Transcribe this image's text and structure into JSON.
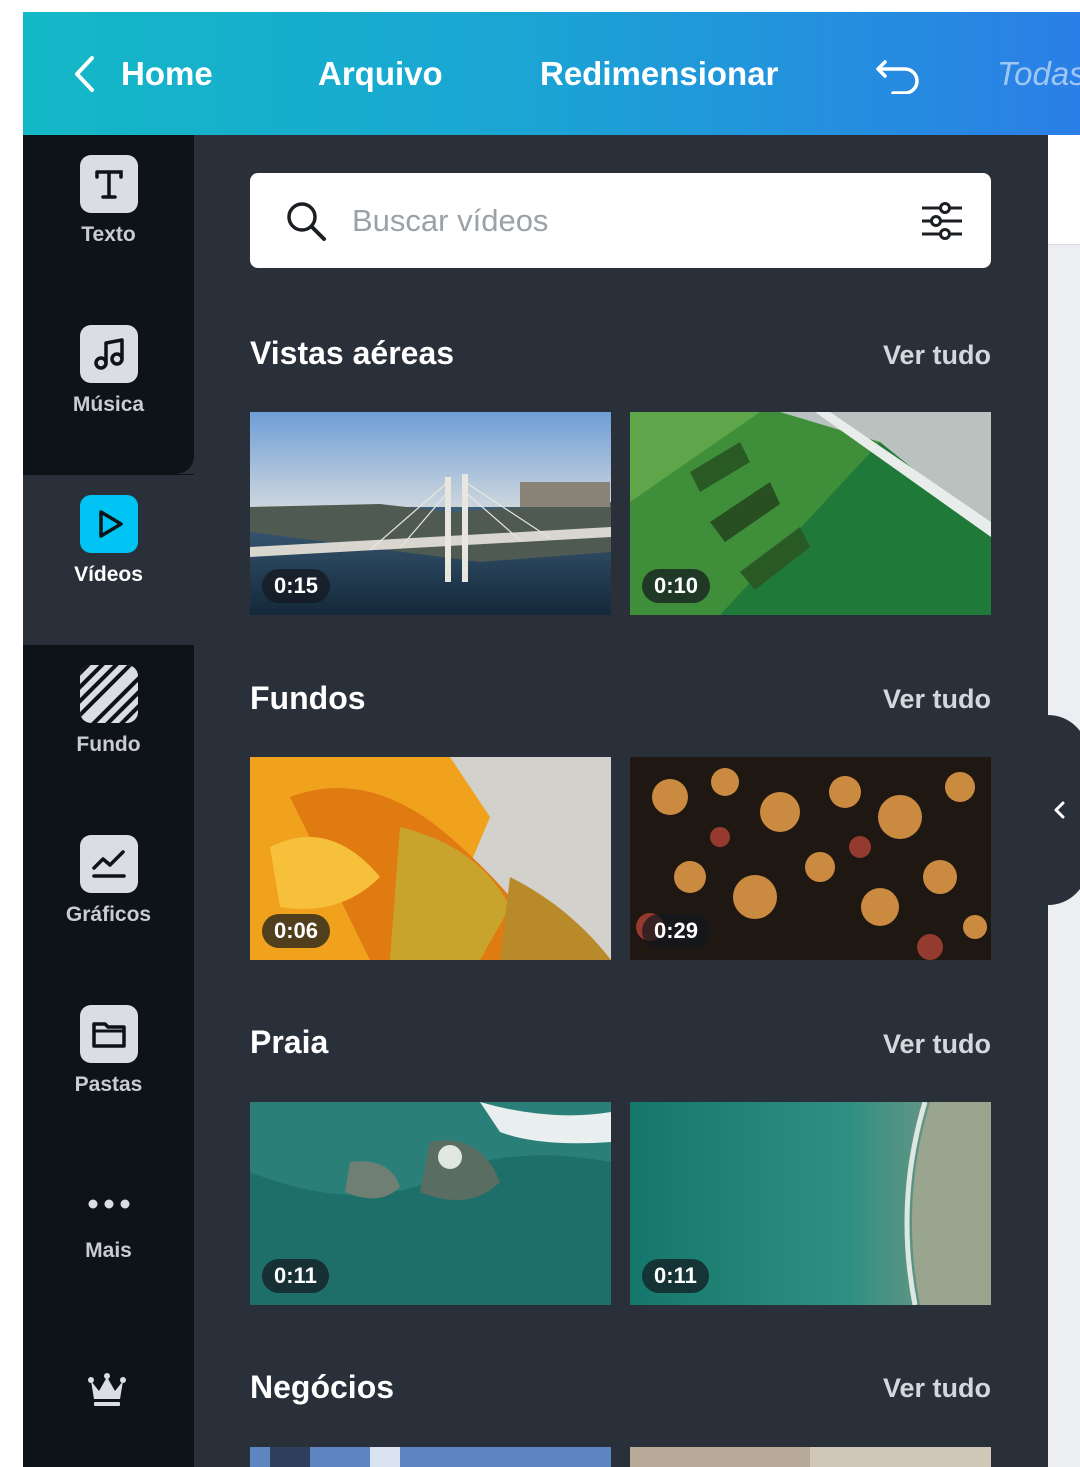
{
  "topbar": {
    "home_label": "Home",
    "arquivo_label": "Arquivo",
    "redimensionar_label": "Redimensionar",
    "todas_label": "Todas"
  },
  "rail": {
    "items": [
      {
        "label": "Texto",
        "icon": "text-icon"
      },
      {
        "label": "Música",
        "icon": "music-icon"
      },
      {
        "label": "Vídeos",
        "icon": "play-icon",
        "active": true
      },
      {
        "label": "Fundo",
        "icon": "background-pattern-icon"
      },
      {
        "label": "Gráficos",
        "icon": "chart-icon"
      },
      {
        "label": "Pastas",
        "icon": "folder-icon"
      },
      {
        "label": "Mais",
        "icon": "more-icon"
      }
    ],
    "premium_icon": "crown-icon"
  },
  "search": {
    "placeholder": "Buscar vídeos",
    "value": ""
  },
  "sections": [
    {
      "title": "Vistas aéreas",
      "link": "Ver tudo",
      "videos": [
        {
          "duration": "0:15"
        },
        {
          "duration": "0:10"
        }
      ]
    },
    {
      "title": "Fundos",
      "link": "Ver tudo",
      "videos": [
        {
          "duration": "0:06"
        },
        {
          "duration": "0:29"
        }
      ]
    },
    {
      "title": "Praia",
      "link": "Ver tudo",
      "videos": [
        {
          "duration": "0:11"
        },
        {
          "duration": "0:11"
        }
      ]
    },
    {
      "title": "Negócios",
      "link": "Ver tudo",
      "videos": []
    }
  ],
  "colors": {
    "topbar_start": "#13b8c6",
    "topbar_end": "#2b7fe6",
    "rail_bg": "#0e1318",
    "panel_bg": "#293039",
    "active_icon": "#00c4f4"
  }
}
